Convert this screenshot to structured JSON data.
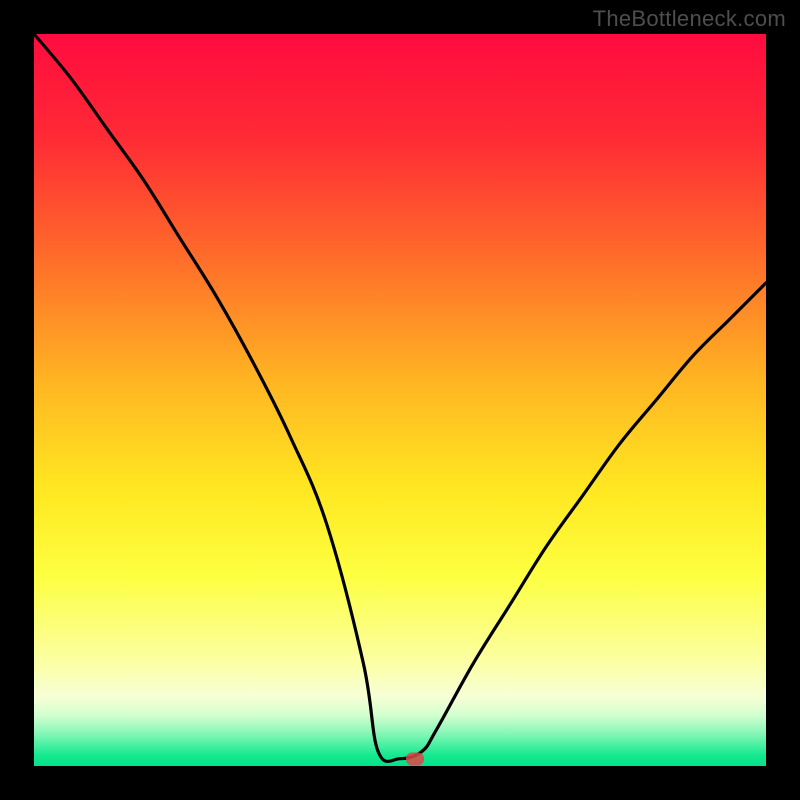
{
  "watermark": "TheBottleneck.com",
  "chart_data": {
    "type": "line",
    "title": "",
    "xlabel": "",
    "ylabel": "",
    "xlim": [
      0,
      100
    ],
    "ylim": [
      0,
      100
    ],
    "x": [
      0,
      5,
      10,
      15,
      20,
      25,
      30,
      35,
      40,
      45,
      47,
      50,
      53,
      55,
      60,
      65,
      70,
      75,
      80,
      85,
      90,
      95,
      100
    ],
    "y": [
      100,
      94,
      87,
      80,
      72,
      64,
      55,
      45,
      33,
      14,
      2,
      1,
      2,
      5,
      14,
      22,
      30,
      37,
      44,
      50,
      56,
      61,
      66
    ],
    "minimum_x": 50,
    "minimum_y": 1,
    "marker": {
      "x": 52,
      "y": 1
    },
    "gradient_bands": [
      {
        "stop": 0.0,
        "color": "#ff0b3f"
      },
      {
        "stop": 0.14,
        "color": "#ff2a35"
      },
      {
        "stop": 0.3,
        "color": "#ff6a2a"
      },
      {
        "stop": 0.48,
        "color": "#ffb722"
      },
      {
        "stop": 0.62,
        "color": "#ffe721"
      },
      {
        "stop": 0.74,
        "color": "#fdff40"
      },
      {
        "stop": 0.86,
        "color": "#fbffa5"
      },
      {
        "stop": 0.905,
        "color": "#f7ffd6"
      },
      {
        "stop": 0.93,
        "color": "#d4ffcf"
      },
      {
        "stop": 0.955,
        "color": "#88f7b8"
      },
      {
        "stop": 0.985,
        "color": "#16e98f"
      },
      {
        "stop": 1.0,
        "color": "#00e28a"
      }
    ]
  }
}
